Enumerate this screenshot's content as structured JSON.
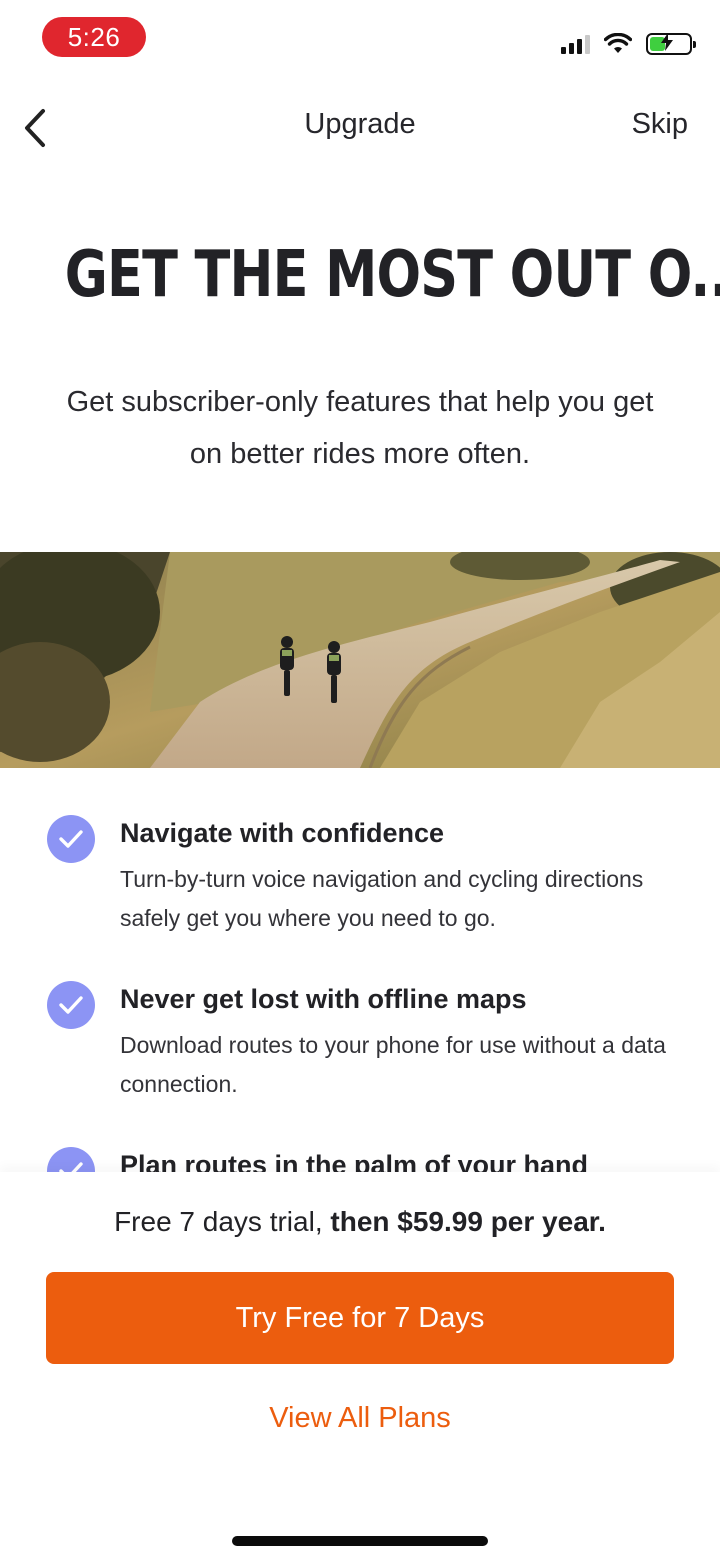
{
  "status_bar": {
    "time": "5:26",
    "battery_color": "#3fcf3f",
    "time_pill_color": "#e0262e"
  },
  "nav": {
    "title": "Upgrade",
    "skip_label": "Skip",
    "back_icon": "chevron-left-icon"
  },
  "hero": {
    "headline": "GET THE MOST OUT O...",
    "subtitle": "Get subscriber-only features that help you get on better rides more often."
  },
  "features": [
    {
      "title": "Navigate with confidence",
      "description": "Turn-by-turn voice navigation and cycling directions safely get you where you need to go."
    },
    {
      "title": "Never get lost with offline maps",
      "description": "Download routes to your phone for use without a data connection."
    },
    {
      "title": "Plan routes in the palm of your hand",
      "description": ""
    }
  ],
  "pricing": {
    "trial_prefix": "Free 7 days trial, ",
    "trial_price": "then $59.99 per year.",
    "cta_label": "Try Free for 7 Days",
    "view_plans_label": "View All Plans",
    "accent_color": "#ec5d0e",
    "check_color": "#8c94f4"
  }
}
